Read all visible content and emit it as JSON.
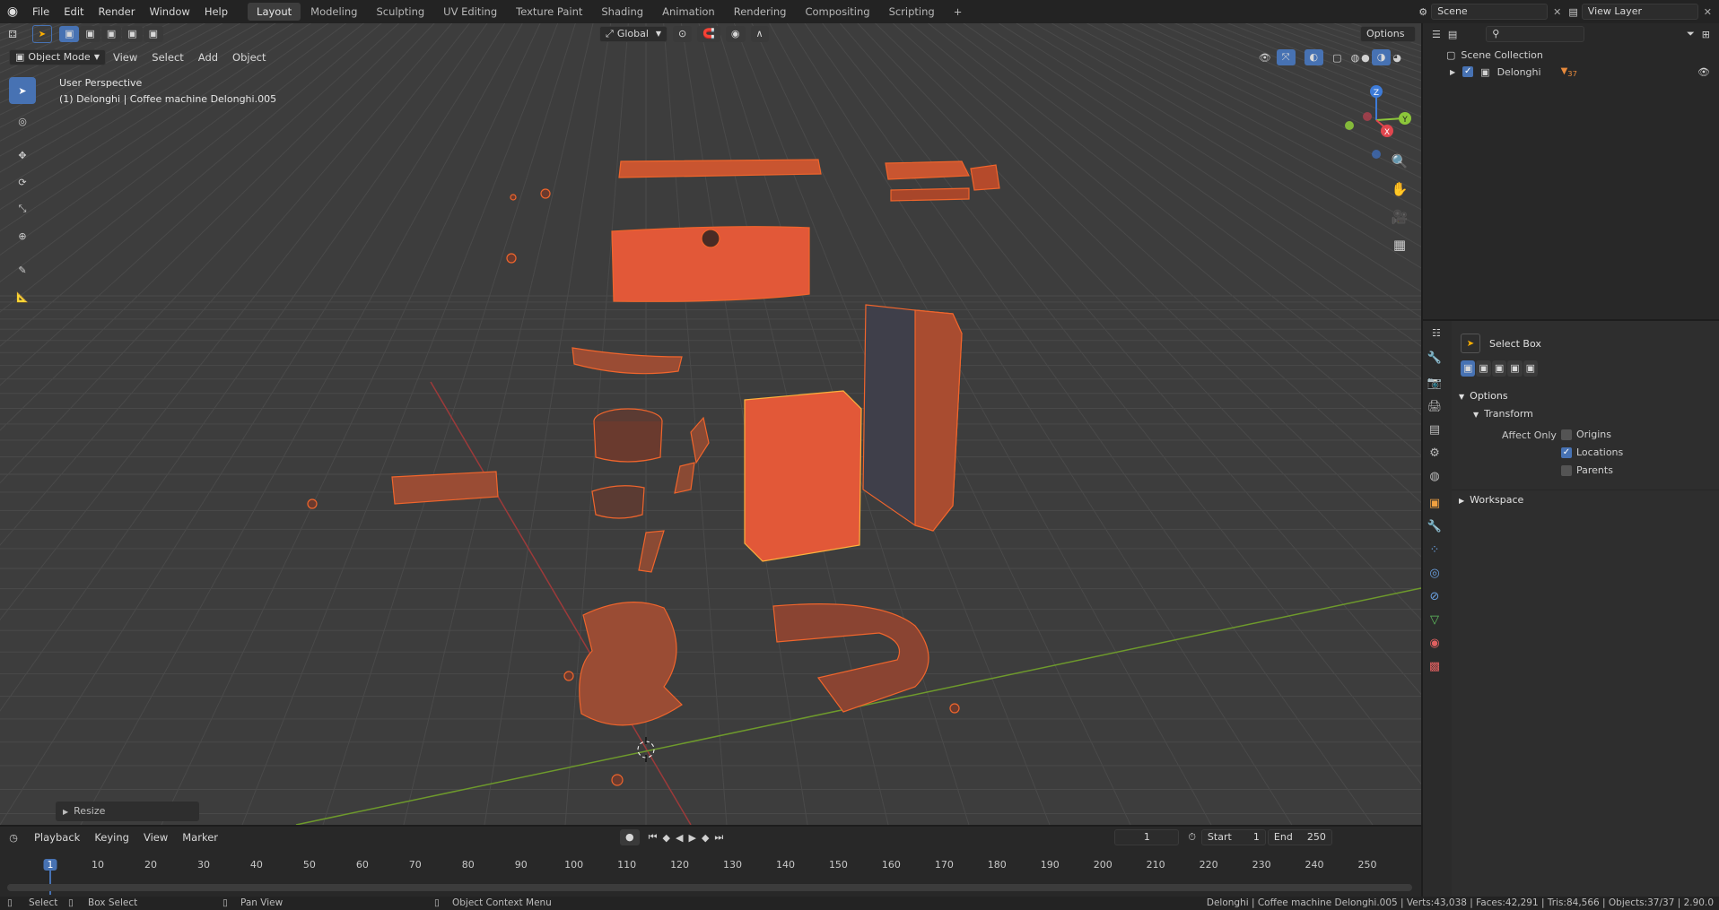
{
  "topbar": {
    "menus": [
      "File",
      "Edit",
      "Render",
      "Window",
      "Help"
    ],
    "workspaces": [
      "Layout",
      "Modeling",
      "Sculpting",
      "UV Editing",
      "Texture Paint",
      "Shading",
      "Animation",
      "Rendering",
      "Compositing",
      "Scripting"
    ],
    "active_workspace": "Layout",
    "add_workspace": "+",
    "scene_name": "Scene",
    "view_layer_name": "View Layer"
  },
  "viewport_header": {
    "mode": "Object Mode",
    "menus": [
      "View",
      "Select",
      "Add",
      "Object"
    ],
    "orientation": "Global",
    "options_label": "Options"
  },
  "viewport": {
    "view_name": "User Perspective",
    "object_info": "(1) Delonghi | Coffee machine Delonghi.005",
    "last_operator": "Resize",
    "gizmo_axes": {
      "z": "Z",
      "y": "Y",
      "x": "X"
    },
    "colors": {
      "background": "#3d3d3d",
      "grid": "#4a4a4a",
      "x_axis": "#9c3a3a",
      "y_axis": "#6e9a2c",
      "selection": "#f0652c",
      "active_selection": "#ffb23c",
      "mesh_fill": "#e25838"
    }
  },
  "tools": [
    "select-box",
    "cursor",
    "move",
    "rotate",
    "scale",
    "transform",
    "annotate",
    "measure"
  ],
  "outliner": {
    "root": "Scene Collection",
    "items": [
      {
        "name": "Delonghi",
        "child_count": "37"
      }
    ]
  },
  "properties": {
    "tool_name": "Select Box",
    "panels": {
      "options": "Options",
      "transform": "Transform",
      "affect_only": "Affect Only",
      "origins": "Origins",
      "locations": "Locations",
      "parents": "Parents",
      "workspace": "Workspace"
    }
  },
  "timeline": {
    "menus": [
      "Playback",
      "Keying",
      "View",
      "Marker"
    ],
    "current_frame": "1",
    "start_label": "Start",
    "start_value": "1",
    "end_label": "End",
    "end_value": "250",
    "ticks": [
      "1",
      "10",
      "20",
      "30",
      "40",
      "50",
      "60",
      "70",
      "80",
      "90",
      "100",
      "110",
      "120",
      "130",
      "140",
      "150",
      "160",
      "170",
      "180",
      "190",
      "200",
      "210",
      "220",
      "230",
      "240",
      "250"
    ]
  },
  "statusbar": {
    "select": "Select",
    "box_select": "Box Select",
    "pan_view": "Pan View",
    "context_menu": "Object Context Menu",
    "stats": "Delonghi | Coffee machine Delonghi.005 | Verts:43,038 | Faces:42,291 | Tris:84,566 | Objects:37/37 | 2.90.0"
  }
}
